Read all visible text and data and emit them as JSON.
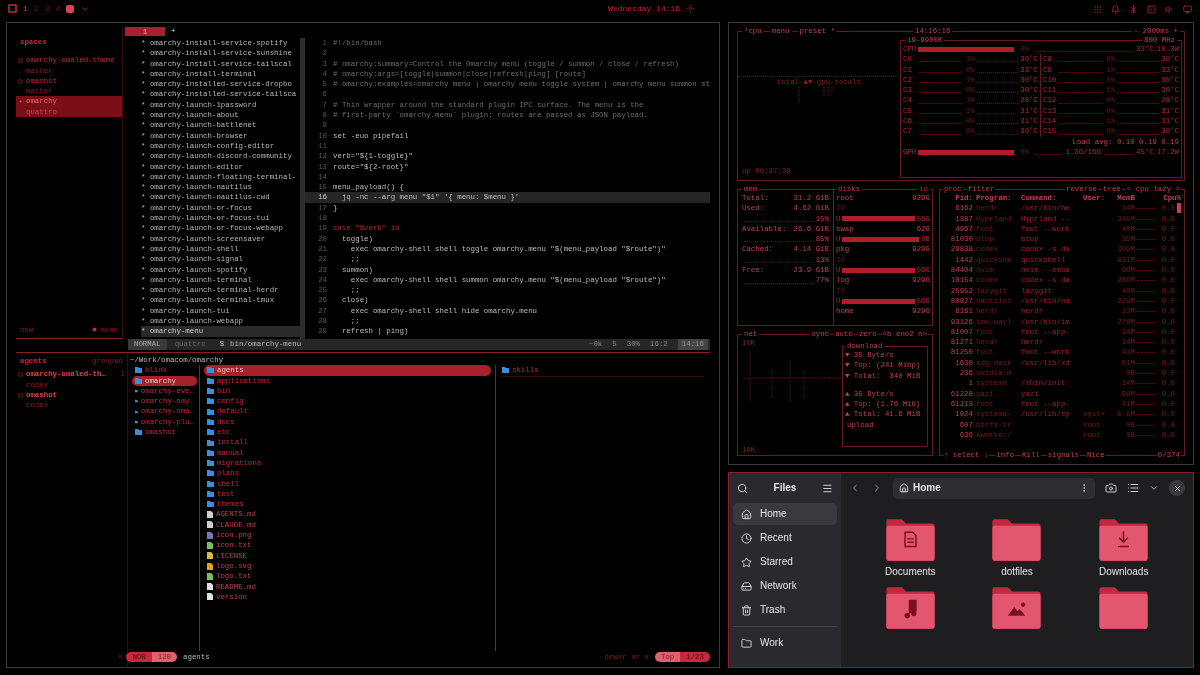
{
  "topbar": {
    "workspaces": [
      {
        "label": "1",
        "selected": true
      },
      {
        "label": "2",
        "selected": false
      },
      {
        "label": "3",
        "selected": false
      },
      {
        "label": "4",
        "selected": false
      }
    ],
    "clock": "Wednesday 14:16"
  },
  "spaces": {
    "title": "spaces",
    "items": [
      {
        "name": "omarchy-omaled-theme",
        "branch": "master",
        "selected": false
      },
      {
        "name": "omashot",
        "branch": "master",
        "selected": false
      },
      {
        "name": "omarchy",
        "branch": "quattro",
        "selected": true
      }
    ],
    "new": "new",
    "menu": "menu"
  },
  "tabs": [
    {
      "label": "1",
      "selected": true
    }
  ],
  "new_tab": "+",
  "file_list": {
    "bullet": "*",
    "items": [
      {
        "name": "omarchy-install-service-spotify",
        "selected": false
      },
      {
        "name": "omarchy-install-service-sunshine",
        "selected": false
      },
      {
        "name": "omarchy-install-service-tailscal",
        "selected": false
      },
      {
        "name": "omarchy-install-terminal",
        "selected": false
      },
      {
        "name": "omarchy-installed-service-dropbo",
        "selected": false
      },
      {
        "name": "omarchy-installed-service-tailsca",
        "selected": false
      },
      {
        "name": "omarchy-launch-1password",
        "selected": false
      },
      {
        "name": "omarchy-launch-about",
        "selected": false
      },
      {
        "name": "omarchy-launch-battlenet",
        "selected": false
      },
      {
        "name": "omarchy-launch-browser",
        "selected": false
      },
      {
        "name": "omarchy-launch-config-editor",
        "selected": false
      },
      {
        "name": "omarchy-launch-discord-community",
        "selected": false
      },
      {
        "name": "omarchy-launch-editor",
        "selected": false
      },
      {
        "name": "omarchy-launch-floating-terminal-",
        "selected": false
      },
      {
        "name": "omarchy-launch-nautilus",
        "selected": false
      },
      {
        "name": "omarchy-launch-nautilus-cwd",
        "selected": false
      },
      {
        "name": "omarchy-launch-or-focus",
        "selected": false
      },
      {
        "name": "omarchy-launch-or-focus-tui",
        "selected": false
      },
      {
        "name": "omarchy-launch-or-focus-webapp",
        "selected": false
      },
      {
        "name": "omarchy-launch-screensaver",
        "selected": false
      },
      {
        "name": "omarchy-launch-shell",
        "selected": false
      },
      {
        "name": "omarchy-launch-signal",
        "selected": false
      },
      {
        "name": "omarchy-launch-spotify",
        "selected": false
      },
      {
        "name": "omarchy-launch-terminal",
        "selected": false
      },
      {
        "name": "omarchy-launch-terminal-herdr",
        "selected": false
      },
      {
        "name": "omarchy-launch-terminal-tmux",
        "selected": false
      },
      {
        "name": "omarchy-launch-tui",
        "selected": false
      },
      {
        "name": "omarchy-launch-webapp",
        "selected": false
      },
      {
        "name": "omarchy-menu",
        "selected": true
      }
    ]
  },
  "code": [
    {
      "n": "1",
      "text": "#!/bin/bash",
      "kind": "comment",
      "selected": false
    },
    {
      "n": "2",
      "selected": false
    },
    {
      "n": "3",
      "text": "# omarchy:summary=Control the Omarchy menu (toggle / summon / close / refresh)",
      "kind": "comment",
      "selected": false
    },
    {
      "n": "4",
      "text": "# omarchy:args=[toggle|summon|close|refresh|ping] [route]",
      "kind": "comment",
      "selected": false
    },
    {
      "n": "5",
      "text": "# omarchy:examples=omarchy menu | omarchy menu toggle system | omarchy menu summon st",
      "kind": "comment",
      "selected": false
    },
    {
      "n": "6",
      "selected": false
    },
    {
      "n": "7",
      "text": "# Thin wrapper around the standard plugin IPC surface. The menu is the",
      "kind": "comment",
      "selected": false
    },
    {
      "n": "8",
      "text": "# first-party `omarchy.menu` plugin; routes are passed as JSON payload.",
      "kind": "comment",
      "selected": false
    },
    {
      "n": "9",
      "selected": false
    },
    {
      "n": "10",
      "text": "set -euo pipefail",
      "kind": "code",
      "selected": false
    },
    {
      "n": "11",
      "selected": false
    },
    {
      "n": "12",
      "text": "verb=\"${1-toggle}\"",
      "kind": "code",
      "selected": false
    },
    {
      "n": "13",
      "text": "route=\"${2-root}\"",
      "kind": "code",
      "selected": false
    },
    {
      "n": "14",
      "selected": false
    },
    {
      "n": "15",
      "text": "menu_payload() {",
      "kind": "code",
      "selected": false
    },
    {
      "n": "16",
      "text": "  jq -nc --arg menu \"$1\" '{ menu: $menu }'",
      "kind": "code",
      "selected": true
    },
    {
      "n": "17",
      "text": "}",
      "kind": "code",
      "selected": false
    },
    {
      "n": "18",
      "selected": false
    },
    {
      "n": "19",
      "text": "case \"$verb\" in",
      "kind": "keyword",
      "selected": false
    },
    {
      "n": "20",
      "text": "  toggle)",
      "kind": "code",
      "selected": false
    },
    {
      "n": "21",
      "text": "    exec omarchy-shell shell toggle omarchy.menu \"$(menu_payload \"$route\")\"",
      "kind": "code",
      "selected": false
    },
    {
      "n": "22",
      "text": "    ;;",
      "kind": "code",
      "selected": false
    },
    {
      "n": "23",
      "text": "  summon)",
      "kind": "code",
      "selected": false
    },
    {
      "n": "24",
      "text": "    exec omarchy-shell shell summon omarchy.menu \"$(menu_payload \"$route\")\"",
      "kind": "code",
      "selected": false
    },
    {
      "n": "25",
      "text": "    ;;",
      "kind": "code",
      "selected": false
    },
    {
      "n": "26",
      "text": "  close)",
      "kind": "code",
      "selected": false
    },
    {
      "n": "27",
      "text": "    exec omarchy-shell shell hide omarchy.menu",
      "kind": "code",
      "selected": false
    },
    {
      "n": "28",
      "text": "    ;;",
      "kind": "code",
      "selected": false
    },
    {
      "n": "29",
      "text": "  refresh | ping)",
      "kind": "code",
      "selected": false
    }
  ],
  "status": {
    "mode": "NORMAL",
    "branch": "quattro",
    "prompt": "$",
    "file": "bin/omarchy-menu",
    "count": "~0k",
    "diag": "5",
    "percent": "30%",
    "position": "16:2",
    "time": "14:16"
  },
  "agents": {
    "title": "agents",
    "grouping": "grouped",
    "items": [
      {
        "name": "omarchy-omaled-th…",
        "count": "1",
        "tool": "codex"
      },
      {
        "name": "omashot",
        "tool": "codex"
      }
    ]
  },
  "yazi": {
    "path": "~/Work/omacom/omarchy",
    "parent": [
      {
        "name": "blink",
        "selected": false
      },
      {
        "name": "omarchy",
        "selected": true
      },
      {
        "name": "omarchy-eve…",
        "selected": false
      },
      {
        "name": "omarchy-nay…",
        "selected": false
      },
      {
        "name": "omarchy-oma…",
        "selected": false
      },
      {
        "name": "omarchy-plu…",
        "selected": false
      },
      {
        "name": "omashot",
        "selected": false
      }
    ],
    "current": [
      {
        "name": "agents",
        "kind": "folder",
        "selected": true
      },
      {
        "name": "applications",
        "kind": "folder",
        "selected": false
      },
      {
        "name": "bin",
        "kind": "folder",
        "selected": false
      },
      {
        "name": "config",
        "kind": "folder",
        "selected": false
      },
      {
        "name": "default",
        "kind": "folder",
        "selected": false
      },
      {
        "name": "docs",
        "kind": "folder",
        "selected": false
      },
      {
        "name": "etc",
        "kind": "folder",
        "selected": false
      },
      {
        "name": "install",
        "kind": "folder",
        "selected": false
      },
      {
        "name": "manual",
        "kind": "folder",
        "selected": false
      },
      {
        "name": "migrations",
        "kind": "folder",
        "selected": false
      },
      {
        "name": "plans",
        "kind": "folder",
        "selected": false
      },
      {
        "name": "shell",
        "kind": "folder",
        "selected": false
      },
      {
        "name": "test",
        "kind": "folder",
        "selected": false
      },
      {
        "name": "themes",
        "kind": "folder",
        "selected": false
      },
      {
        "name": "AGENTS.md",
        "kind": "markdown",
        "selected": false
      },
      {
        "name": "CLAUDE.md",
        "kind": "markdown",
        "selected": false
      },
      {
        "name": "icon.png",
        "kind": "image",
        "selected": false
      },
      {
        "name": "icon.txt",
        "kind": "text",
        "selected": false
      },
      {
        "name": "LICENSE",
        "kind": "license",
        "selected": false
      },
      {
        "name": "logo.svg",
        "kind": "vector",
        "selected": false
      },
      {
        "name": "logo.txt",
        "kind": "text",
        "selected": false
      },
      {
        "name": "README.md",
        "kind": "readme",
        "selected": false
      },
      {
        "name": "version",
        "kind": "file",
        "selected": false
      }
    ],
    "preview": [
      {
        "name": "skills",
        "kind": "folder"
      }
    ],
    "back": "«",
    "mode": "NOR",
    "size": "120",
    "name": "agents",
    "perms": "drwxr xr x",
    "scroll": "Top",
    "position": "1/23"
  },
  "btop": {
    "tabs": [
      "¹cpu",
      "menu",
      "preset *"
    ],
    "clock": "14:16:16",
    "interval": "- 2000ms +",
    "graph_label": "total-▲▼-gpu-totals",
    "uptime": "up 00:37:39",
    "cpu": {
      "model": "i9-9900K",
      "freq": "800 MHz",
      "label": "CPU",
      "level": 1,
      "pct": "0%",
      "temp": "33°C",
      "power": "10.3W",
      "cores": [
        {
          "name": "C0",
          "pct": "1%",
          "temp": "30°C"
        },
        {
          "name": "C1",
          "pct": "0%",
          "temp": "33°C"
        },
        {
          "name": "C2",
          "pct": "1%",
          "temp": "30°C"
        },
        {
          "name": "C3",
          "pct": "0%",
          "temp": "30°C"
        },
        {
          "name": "C4",
          "pct": "1%",
          "temp": "28°C"
        },
        {
          "name": "C5",
          "pct": "1%",
          "temp": "31°C"
        },
        {
          "name": "C6",
          "pct": "0%",
          "temp": "31°C"
        },
        {
          "name": "C7",
          "pct": "0%",
          "temp": "30°C"
        },
        {
          "name": "C8",
          "pct": "0%",
          "temp": "30°C"
        },
        {
          "name": "C9",
          "pct": "1%",
          "temp": "33°C"
        },
        {
          "name": "C10",
          "pct": "0%",
          "temp": "30°C"
        },
        {
          "name": "C11",
          "pct": "1%",
          "temp": "30°C"
        },
        {
          "name": "C12",
          "pct": "0%",
          "temp": "28°C"
        },
        {
          "name": "C13",
          "pct": "0%",
          "temp": "31°C"
        },
        {
          "name": "C14",
          "pct": "1%",
          "temp": "31°C"
        },
        {
          "name": "C15",
          "pct": "0%",
          "temp": "30°C"
        }
      ],
      "load": "Load avg: 0.10 0.19 0.19"
    },
    "gpu": {
      "label": "GPU",
      "level": 1,
      "pct": "0%",
      "mem": "1.3G/16G",
      "temp": "45°C",
      "power": "17.2W"
    },
    "mem": {
      "title": "mem",
      "rows": [
        {
          "label": "Total:",
          "value": "31.2 GiB"
        },
        {
          "label": "Used:",
          "value": "4.62 GiB",
          "pct": "15%"
        },
        {
          "label": "Available:",
          "value": "26.6 GiB",
          "pct": "85%"
        },
        {
          "label": "Cached:",
          "value": "4.14 GiB",
          "pct": "13%"
        },
        {
          "label": "Free:",
          "value": "23.9 GiB",
          "pct": "77%"
        }
      ]
    },
    "disks": {
      "title": "disks",
      "io_title": "io",
      "items": [
        {
          "name": "root",
          "size": "929G",
          "io": "IO",
          "used_label": "U",
          "used": "56G",
          "level": 1
        },
        {
          "name": "swap",
          "size": "62G",
          "used_label": "U",
          "used": "0B",
          "level": 1
        },
        {
          "name": "pkg",
          "size": "929G",
          "io": "IO",
          "used_label": "U",
          "used": "56G",
          "level": 1
        },
        {
          "name": "log",
          "size": "929G",
          "io": "IO",
          "used_label": "U",
          "used": "56G",
          "level": 1
        },
        {
          "name": "home",
          "size": "929G"
        }
      ]
    },
    "net": {
      "title": "net",
      "tabs": [
        "sync",
        "auto",
        "zero",
        "<b eno2 n>"
      ],
      "scale_top": "10K",
      "scale_bottom": "10K",
      "download_title": "download",
      "upload_title": "upload",
      "download": [
        "▼ 35 Byte/s",
        "▼ Top: (241 Mibp)",
        "▼ Total:  340 MiB"
      ],
      "upload": [
        "▲ 35 Byte/s",
        "▲ Top: (1.76 Mib)",
        "▲ Total: 41.6 MiB"
      ]
    },
    "proc": {
      "tabs": [
        "proc",
        "filter",
        "reverse",
        "tree",
        "< cpu lazy >"
      ],
      "columns": [
        "Pid:",
        "Program:",
        "Command:",
        "User:",
        "MemB",
        "Cpu%"
      ],
      "rows": [
        {
          "pid": "6162",
          "program": "herdr",
          "command": "/usr/bin/he",
          "mem": "34M",
          "cpu": "0.0"
        },
        {
          "pid": "1387",
          "program": "Hyprland",
          "command": "Hyprland --",
          "mem": "345M",
          "cpu": "0.0"
        },
        {
          "pid": "4967",
          "program": "foot",
          "command": "foot --work",
          "mem": "48M",
          "cpu": "0.0"
        },
        {
          "pid": "81030",
          "program": "btop",
          "command": "btop",
          "mem": "35M",
          "cpu": "0.0"
        },
        {
          "pid": "29838",
          "program": "codex",
          "command": "codex -s da",
          "mem": "309M",
          "cpu": "0.0"
        },
        {
          "pid": "1442",
          "program": "quickshe",
          "command": "quickshell",
          "mem": "931M",
          "cpu": "0.0"
        },
        {
          "pid": "84404",
          "program": "nvim",
          "command": "nvim --embe",
          "mem": "68M",
          "cpu": "0.0"
        },
        {
          "pid": "10154",
          "program": "codex",
          "command": "codex -s da",
          "mem": "286M",
          "cpu": "0.0"
        },
        {
          "pid": "25952",
          "program": "lazygit",
          "command": "lazygit",
          "mem": "40M",
          "cpu": "0.0"
        },
        {
          "pid": "80827",
          "program": "nautilus",
          "command": "/usr/bin/na",
          "mem": "229M",
          "cpu": "0.0"
        },
        {
          "pid": "6161",
          "program": "herdr",
          "command": "herdr",
          "mem": "13M",
          "cpu": "0.0"
        },
        {
          "pid": "93126",
          "program": "imv-wayl",
          "command": "/usr/bin/im",
          "mem": "276M",
          "cpu": "0.0"
        },
        {
          "pid": "81007",
          "program": "foot",
          "command": "foot --app-",
          "mem": "34M",
          "cpu": "0.0"
        },
        {
          "pid": "81271",
          "program": "herdr",
          "command": "herdr",
          "mem": "14M",
          "cpu": "0.0"
        },
        {
          "pid": "81250",
          "program": "foot",
          "command": "foot --work",
          "mem": "43M",
          "cpu": "0.0"
        },
        {
          "pid": "1630",
          "program": "xdg-desk",
          "command": "/usr/lib/xd",
          "mem": "61M",
          "cpu": "0.0"
        },
        {
          "pid": "236",
          "program": "nvidia-m",
          "mem": "0B",
          "cpu": "0.0"
        },
        {
          "pid": "1",
          "program": "systemd",
          "command": "/sbin/init",
          "mem": "14M",
          "cpu": "0.0"
        },
        {
          "pid": "61228",
          "program": "yazi",
          "command": "yazi",
          "mem": "98M",
          "cpu": "0.0"
        },
        {
          "pid": "61213",
          "program": "foot",
          "command": "foot --app-",
          "mem": "41M",
          "cpu": "0.0"
        },
        {
          "pid": "1024",
          "program": "systemd-",
          "command": "/usr/lib/sy",
          "user": "syst+",
          "mem": "5.6M",
          "cpu": "0.0"
        },
        {
          "pid": "607",
          "program": "btrfs-tr",
          "user": "root",
          "mem": "0B",
          "cpu": "0.0"
        },
        {
          "pid": "636",
          "program": "kworker/",
          "user": "root",
          "mem": "0B",
          "cpu": "0.0"
        }
      ],
      "footer": [
        "↑ select ↓",
        "info",
        "Kill",
        "signals",
        "Nice"
      ],
      "count": "0/374"
    }
  },
  "files": {
    "title": "Files",
    "location": "Home",
    "sidebar": [
      {
        "label": "Home",
        "kind": "home",
        "selected": true
      },
      {
        "label": "Recent",
        "kind": "recent",
        "selected": false
      },
      {
        "label": "Starred",
        "kind": "starred",
        "selected": false
      },
      {
        "label": "Network",
        "kind": "network",
        "selected": false
      },
      {
        "label": "Trash",
        "kind": "trash",
        "selected": false
      }
    ],
    "bookmarks": [
      {
        "label": "Work",
        "kind": "folder",
        "selected": false
      }
    ],
    "folders": [
      {
        "label": "Documents",
        "kind": "document"
      },
      {
        "label": "dotfiles",
        "kind": "plain"
      },
      {
        "label": "Downloads",
        "kind": "download"
      },
      {
        "kind": "music"
      },
      {
        "kind": "picture"
      },
      {
        "kind": "plain"
      }
    ]
  }
}
